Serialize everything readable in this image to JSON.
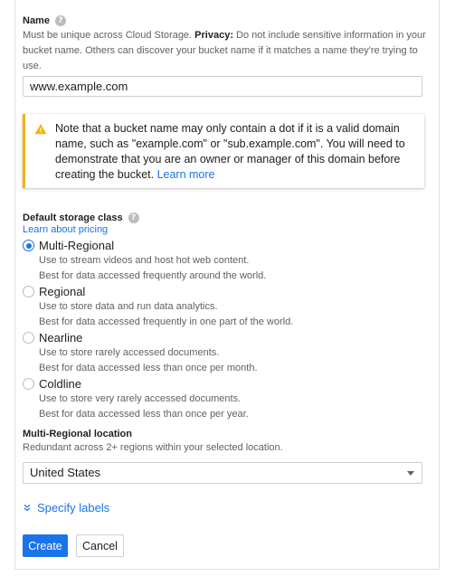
{
  "name_field": {
    "label": "Name",
    "help_icon": "?",
    "desc_before": "Must be unique across Cloud Storage. ",
    "desc_bold": "Privacy:",
    "desc_after": " Do not include sensitive information in your bucket name. Others can discover your bucket name if it matches a name they're trying to use.",
    "value": "www.example.com"
  },
  "warning": {
    "icon": "warning-icon",
    "text": "Note that a bucket name may only contain a dot if it is a valid domain name, such as \"example.com\" or \"sub.example.com\". You will need to demonstrate that you are an owner or manager of this domain before creating the bucket. ",
    "link": "Learn more",
    "accent_color": "#f4b400"
  },
  "storage_class": {
    "label": "Default storage class",
    "help_icon": "?",
    "pricing_link": "Learn about pricing",
    "options": [
      {
        "title": "Multi-Regional",
        "checked": true,
        "line1": "Use to stream videos and host hot web content.",
        "line2": "Best for data accessed frequently around the world."
      },
      {
        "title": "Regional",
        "checked": false,
        "line1": "Use to store data and run data analytics.",
        "line2": "Best for data accessed frequently in one part of the world."
      },
      {
        "title": "Nearline",
        "checked": false,
        "line1": "Use to store rarely accessed documents.",
        "line2": "Best for data accessed less than once per month."
      },
      {
        "title": "Coldline",
        "checked": false,
        "line1": "Use to store very rarely accessed documents.",
        "line2": "Best for data accessed less than once per year."
      }
    ]
  },
  "location": {
    "label": "Multi-Regional location",
    "desc": "Redundant across 2+ regions within your selected location.",
    "selected": "United States"
  },
  "labels_toggle": "Specify labels",
  "buttons": {
    "create": "Create",
    "cancel": "Cancel"
  },
  "colors": {
    "accent": "#1a73e8",
    "warning": "#f4b400"
  }
}
